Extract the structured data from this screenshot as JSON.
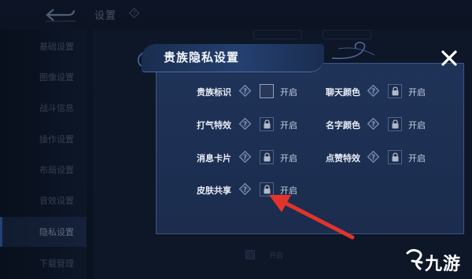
{
  "header": {
    "title": "设置"
  },
  "sidebar": {
    "items": [
      {
        "label": "基础设置"
      },
      {
        "label": "图像设置"
      },
      {
        "label": "战斗信息"
      },
      {
        "label": "操作设置"
      },
      {
        "label": "布局设置"
      },
      {
        "label": "音效设置"
      },
      {
        "label": "隐私设置"
      },
      {
        "label": "下载管理"
      }
    ],
    "active_index": 6
  },
  "background": {
    "bottom_open_label": "开启"
  },
  "modal": {
    "title": "贵族隐私设置",
    "left_rows": [
      {
        "label": "贵族标识",
        "state": "checkbox",
        "option": "开启"
      },
      {
        "label": "打气特效",
        "state": "locked",
        "option": "开启"
      },
      {
        "label": "消息卡片",
        "state": "locked",
        "option": "开启"
      },
      {
        "label": "皮肤共享",
        "state": "locked",
        "option": "开启"
      }
    ],
    "right_rows": [
      {
        "label": "聊天颜色",
        "state": "locked",
        "option": "开启"
      },
      {
        "label": "名字颜色",
        "state": "locked",
        "option": "开启"
      },
      {
        "label": "点赞特效",
        "state": "locked",
        "option": "开启"
      }
    ]
  },
  "watermark": {
    "text": "九游"
  },
  "colors": {
    "accent_arrow": "#e0342c",
    "modal_bg": "#1f3358",
    "text_primary": "#e8edf6"
  }
}
